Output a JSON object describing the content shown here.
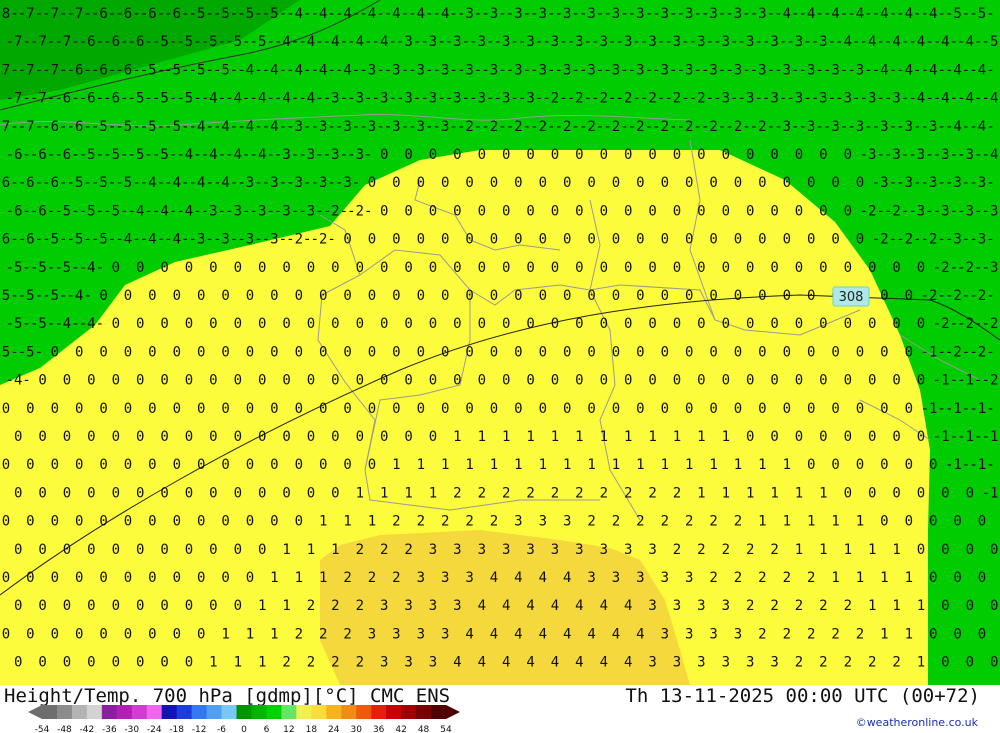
{
  "title": {
    "left": "Height/Temp. 700 hPa [gdmp][°C] CMC ENS",
    "right": "Th 13-11-2025 00:00 UTC (00+72)"
  },
  "credit": "©weatheronline.co.uk",
  "contour_label": "308",
  "colors": {
    "green": "#00cc00",
    "dark_green": "#00a800",
    "yellow": "#fcfc3c",
    "orange_yellow": "#f5d83c",
    "label_text": "#111111",
    "border": "#9a9a9a"
  },
  "legend": {
    "ticks": [
      "-54",
      "-48",
      "-42",
      "-36",
      "-30",
      "-24",
      "-18",
      "-12",
      "-6",
      "0",
      "6",
      "12",
      "18",
      "24",
      "30",
      "36",
      "42",
      "48",
      "54"
    ],
    "colors": [
      "#6e6e6e",
      "#8c8c8c",
      "#b4b4b4",
      "#d2d2d2",
      "#8c1ea0",
      "#b41eb4",
      "#d23cd2",
      "#f064f0",
      "#1414b4",
      "#1e3cdc",
      "#3278f0",
      "#50a0f0",
      "#78c8f8",
      "#009600",
      "#00b400",
      "#00d200",
      "#64e664",
      "#f0f050",
      "#fadc3c",
      "#f5b41e",
      "#f08c14",
      "#f05a0a",
      "#e61e0a",
      "#c80000",
      "#a00000",
      "#780000",
      "#500000"
    ]
  }
}
